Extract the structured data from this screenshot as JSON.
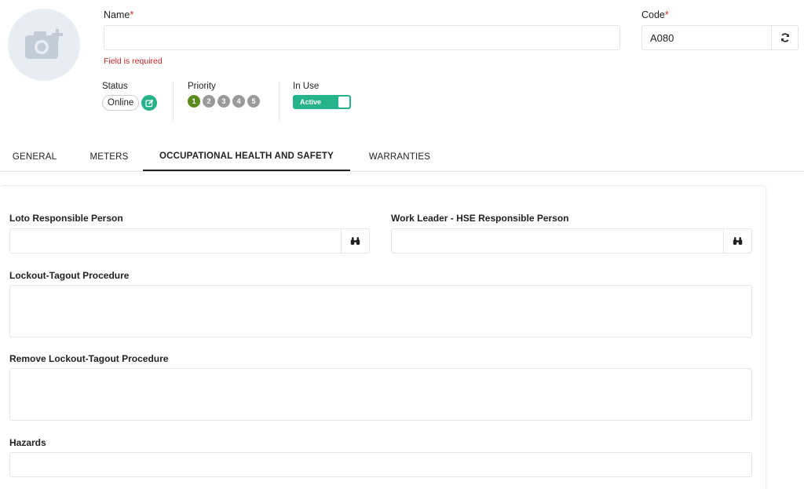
{
  "header": {
    "name_label": "Name",
    "name_value": "",
    "required_mark": "*",
    "name_error": "Field is required",
    "code_label": "Code",
    "code_value": "A080"
  },
  "meta": {
    "status_label": "Status",
    "status_value": "Online",
    "priority_label": "Priority",
    "priorities": [
      "1",
      "2",
      "3",
      "4",
      "5"
    ],
    "priority_selected": "1",
    "inuse_label": "In Use",
    "inuse_value": "Active"
  },
  "tabs": [
    {
      "label": "GENERAL",
      "active": false
    },
    {
      "label": "METERS",
      "active": false
    },
    {
      "label": "OCCUPATIONAL HEALTH AND SAFETY",
      "active": true
    },
    {
      "label": "WARRANTIES",
      "active": false
    }
  ],
  "form": {
    "loto_label": "Loto Responsible Person",
    "loto_value": "",
    "work_leader_label": "Work Leader - HSE Responsible Person",
    "work_leader_value": "",
    "lockout_label": "Lockout-Tagout Procedure",
    "lockout_value": "",
    "remove_lockout_label": "Remove Lockout-Tagout Procedure",
    "remove_lockout_value": "",
    "hazards_label": "Hazards",
    "hazards_value": ""
  },
  "colors": {
    "accent": "#26b28a",
    "error": "#c62828",
    "priority_active": "#5a8a1e",
    "priority_inactive": "#9a9a9a"
  },
  "icons": {
    "avatar": "camera-plus-icon",
    "refresh": "refresh-icon",
    "edit": "edit-icon",
    "lookup": "binoculars-icon"
  }
}
